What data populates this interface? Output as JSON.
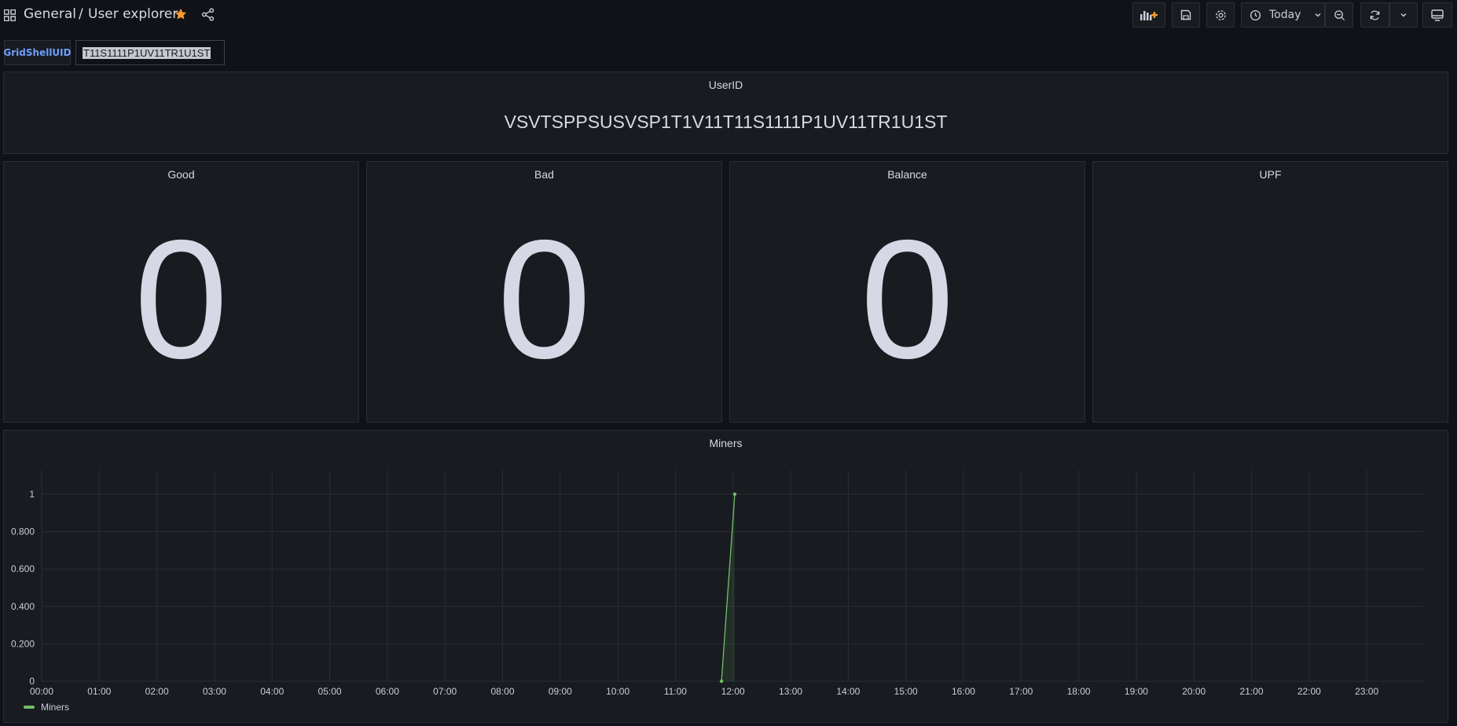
{
  "header": {
    "folder": "General",
    "separator": "/",
    "title": "User explorer",
    "time_range_label": "Today",
    "icons": [
      "apps-icon",
      "star-icon",
      "share-icon",
      "add-panel-icon",
      "save-icon",
      "settings-icon",
      "clock-icon",
      "chevron-down-icon",
      "zoom-out-icon",
      "refresh-icon",
      "tv-icon"
    ],
    "accent_color": "#ff9830"
  },
  "variables": {
    "label": "GridShellUID",
    "value": "T11S1111P1UV11TR1U1ST"
  },
  "panels": {
    "userid": {
      "title": "UserID",
      "value": "VSVTSPPSUSVSP1T1V11T11S1111P1UV11TR1U1ST"
    },
    "good": {
      "title": "Good",
      "value": "0"
    },
    "bad": {
      "title": "Bad",
      "value": "0"
    },
    "balance": {
      "title": "Balance",
      "value": "0"
    },
    "upf": {
      "title": "UPF",
      "value": ""
    },
    "miners": {
      "title": "Miners"
    }
  },
  "chart_data": {
    "type": "line",
    "title": "Miners",
    "x_ticks": [
      "00:00",
      "01:00",
      "02:00",
      "03:00",
      "04:00",
      "05:00",
      "06:00",
      "07:00",
      "08:00",
      "09:00",
      "10:00",
      "11:00",
      "12:00",
      "13:00",
      "14:00",
      "15:00",
      "16:00",
      "17:00",
      "18:00",
      "19:00",
      "20:00",
      "21:00",
      "22:00",
      "23:00"
    ],
    "y_ticks": [
      "0",
      "0.200",
      "0.400",
      "0.600",
      "0.800",
      "1"
    ],
    "xlim_hours": [
      0,
      23.98
    ],
    "ylim": [
      0,
      1.0
    ],
    "series": [
      {
        "name": "Miners",
        "color": "#73bf69",
        "x_hours": [
          11.8,
          12.03
        ],
        "values": [
          0,
          1
        ]
      }
    ],
    "grid": true,
    "legend": "bottom-left"
  }
}
